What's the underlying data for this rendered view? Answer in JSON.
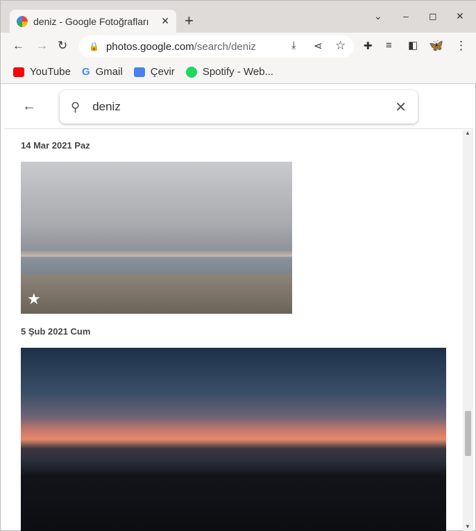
{
  "browser": {
    "tab_title": "deniz - Google Fotoğrafları",
    "url_host": "photos.google.com",
    "url_path": "/search/deniz"
  },
  "bookmarks": [
    {
      "label": "YouTube",
      "color": "#ff0000"
    },
    {
      "label": "Gmail",
      "color": "#4285f4"
    },
    {
      "label": "Çevir",
      "color": "#4a80f0"
    },
    {
      "label": "Spotify - Web...",
      "color": "#1ed760"
    }
  ],
  "search": {
    "query": "deniz"
  },
  "groups": [
    {
      "date": "14 Mar 2021 Paz",
      "favorite": true
    },
    {
      "date": "5 Şub 2021 Cum",
      "favorite": false
    }
  ]
}
